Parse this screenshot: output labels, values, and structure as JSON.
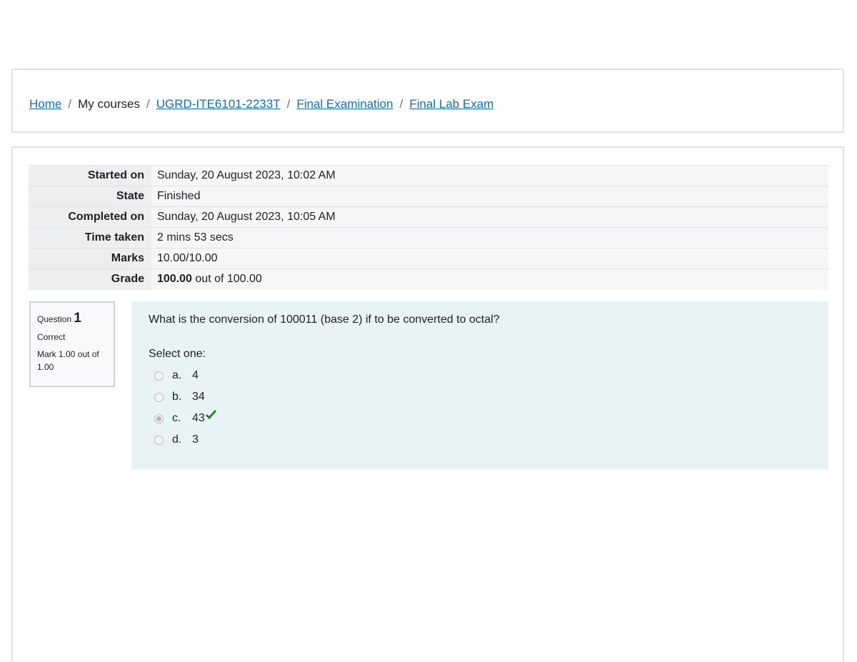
{
  "breadcrumb": {
    "home": "Home",
    "my_courses": "My courses",
    "course": "UGRD-ITE6101-2233T",
    "section": "Final Examination",
    "quiz": "Final Lab Exam",
    "separator": "/"
  },
  "summary": {
    "rows": [
      {
        "label": "Started on",
        "value": "Sunday, 20 August 2023, 10:02 AM"
      },
      {
        "label": "State",
        "value": "Finished"
      },
      {
        "label": "Completed on",
        "value": "Sunday, 20 August 2023, 10:05 AM"
      },
      {
        "label": "Time taken",
        "value": "2 mins 53 secs"
      },
      {
        "label": "Marks",
        "value": "10.00/10.00"
      }
    ],
    "grade_label": "Grade",
    "grade_value": "100.00",
    "grade_suffix": "out of 100.00"
  },
  "question": {
    "label": "Question",
    "number": "1",
    "state": "Correct",
    "mark": "Mark 1.00 out of 1.00",
    "text": "What is the conversion of 100011 (base 2) if to be converted to octal?",
    "prompt": "Select one:",
    "answers": [
      {
        "letter": "a.",
        "text": "4"
      },
      {
        "letter": "b.",
        "text": "34"
      },
      {
        "letter": "c.",
        "text": "43"
      },
      {
        "letter": "d.",
        "text": "3"
      }
    ],
    "selected": "c.",
    "correct_icon": "check-icon",
    "correct_color": "#357a32"
  },
  "colors": {
    "link": "#0f6cbf",
    "question_bg": "#e7f3f5"
  }
}
